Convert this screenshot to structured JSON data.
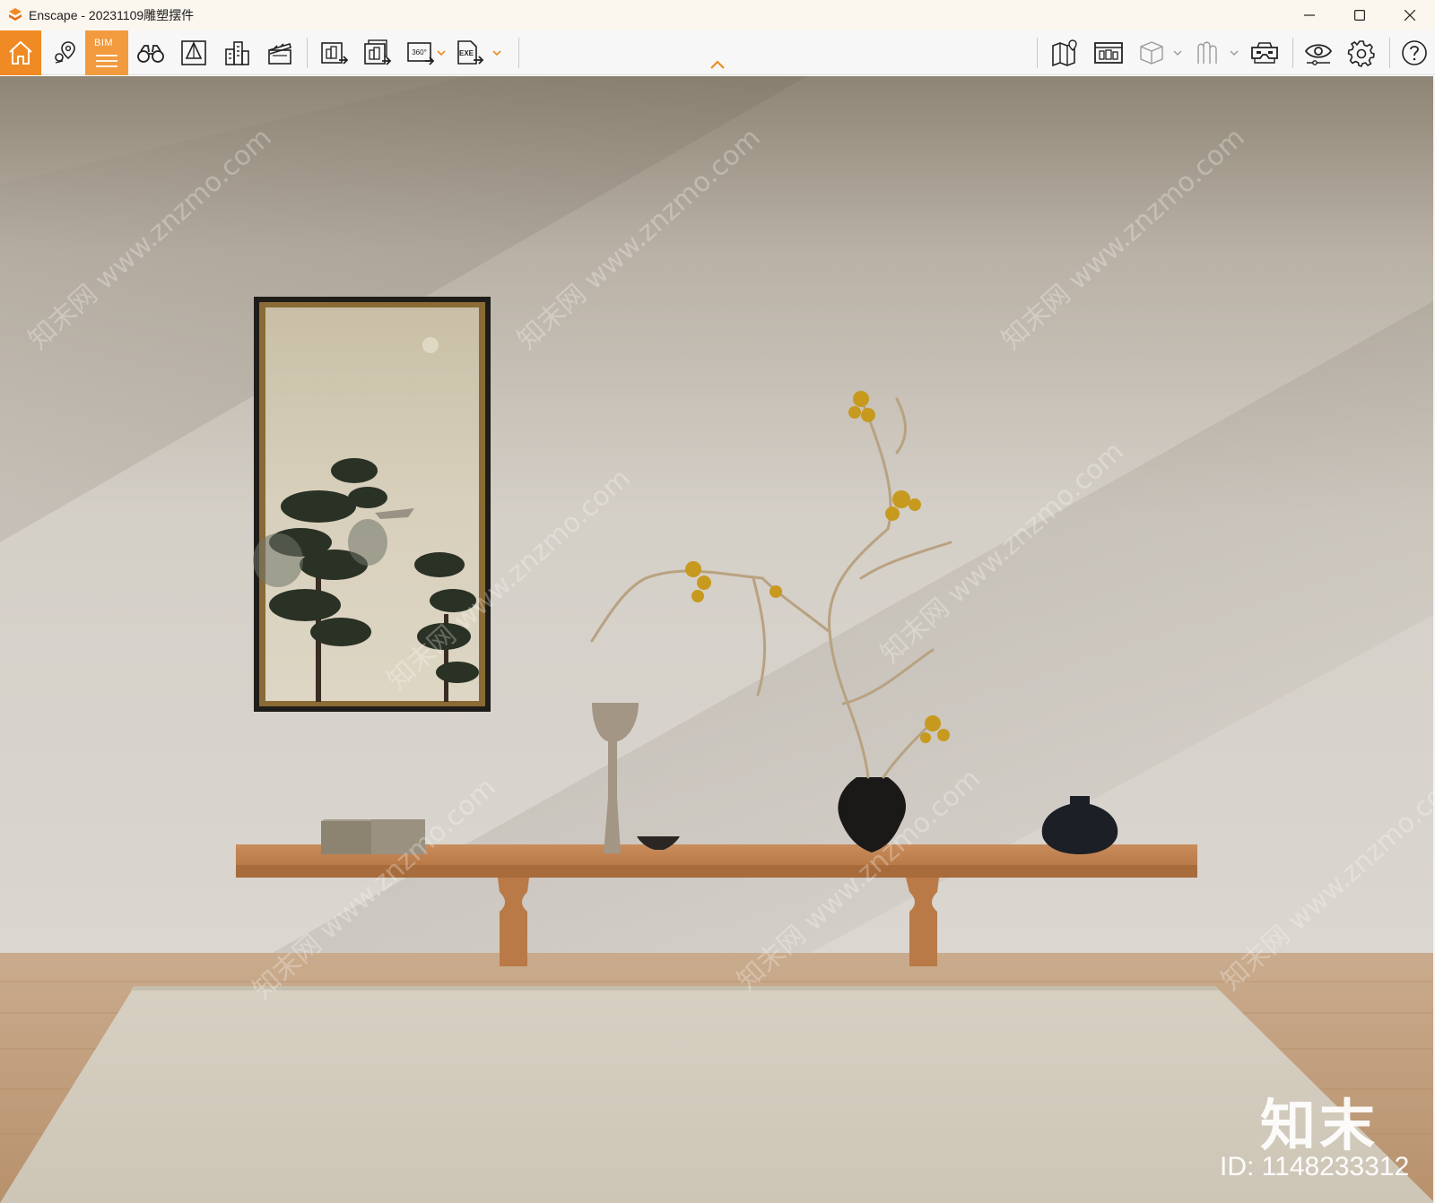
{
  "window": {
    "title": "Enscape - 20231109雕塑摆件",
    "accent_color": "#f08a24"
  },
  "toolbar": {
    "bim_label": "BIM",
    "left_tools": [
      {
        "name": "home-icon"
      },
      {
        "name": "location-pin-icon"
      },
      {
        "name": "bim-icon",
        "active": true
      },
      {
        "name": "binoculars-icon"
      },
      {
        "name": "perspective-icon"
      },
      {
        "name": "buildings-icon"
      },
      {
        "name": "clapperboard-icon"
      },
      {
        "name": "screenshot-export-icon"
      },
      {
        "name": "batch-export-icon"
      },
      {
        "name": "panorama-360-icon"
      },
      {
        "name": "exe-export-icon"
      }
    ],
    "panorama_label": "360°",
    "exe_label": "EXE",
    "right_tools": [
      {
        "name": "map-icon"
      },
      {
        "name": "asset-library-icon"
      },
      {
        "name": "cube-icon"
      },
      {
        "name": "material-icon"
      },
      {
        "name": "vr-headset-icon"
      },
      {
        "name": "visual-settings-icon"
      },
      {
        "name": "settings-gear-icon"
      },
      {
        "name": "help-icon"
      }
    ]
  },
  "viewport": {
    "watermark_text": "知末网 www.znzmo.com",
    "brand_mark": "知末",
    "brand_id": "ID: 1148233312"
  }
}
